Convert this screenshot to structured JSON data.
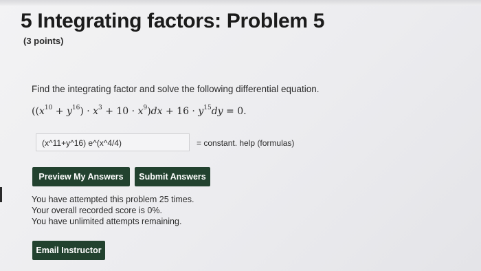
{
  "header": {
    "title": "5 Integrating factors: Problem 5",
    "points": "(3 points)"
  },
  "problem": {
    "prompt": "Find the integrating factor and solve the following differential equation."
  },
  "answer": {
    "value": "(x^11+y^16) e^(x^4/4)",
    "suffix": "= constant. help (formulas)"
  },
  "buttons": {
    "preview": "Preview My Answers",
    "submit": "Submit Answers",
    "email": "Email Instructor"
  },
  "status": {
    "attempts": "You have attempted this problem 25 times.",
    "score": "Your overall recorded score is 0%.",
    "remaining": "You have unlimited attempts remaining."
  }
}
